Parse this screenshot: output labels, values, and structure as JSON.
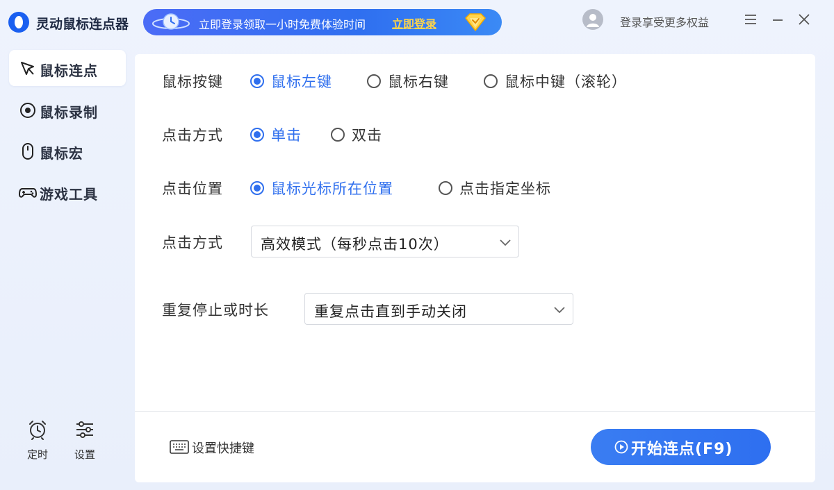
{
  "app": {
    "title": "灵动鼠标连点器"
  },
  "promo": {
    "text": "立即登录领取一小时免费体验时间",
    "link": "立即登录"
  },
  "account": {
    "login_text": "登录享受更多权益"
  },
  "sidebar": {
    "items": [
      {
        "label": "鼠标连点",
        "icon": "cursor-click-icon",
        "active": true
      },
      {
        "label": "鼠标录制",
        "icon": "record-icon",
        "active": false
      },
      {
        "label": "鼠标宏",
        "icon": "mouse-icon",
        "active": false
      },
      {
        "label": "游戏工具",
        "icon": "gamepad-icon",
        "active": false
      }
    ],
    "bottom": [
      {
        "label": "定时",
        "icon": "alarm-clock-icon"
      },
      {
        "label": "设置",
        "icon": "sliders-icon"
      }
    ]
  },
  "form": {
    "mouse_button": {
      "label": "鼠标按键",
      "options": [
        "鼠标左键",
        "鼠标右键",
        "鼠标中键（滚轮）"
      ],
      "selected": "鼠标左键"
    },
    "click_type": {
      "label": "点击方式",
      "options": [
        "单击",
        "双击"
      ],
      "selected": "单击"
    },
    "click_position": {
      "label": "点击位置",
      "options": [
        "鼠标光标所在位置",
        "点击指定坐标"
      ],
      "selected": "鼠标光标所在位置"
    },
    "click_mode": {
      "label": "点击方式",
      "value": "高效模式（每秒点击10次）"
    },
    "repeat": {
      "label": "重复停止或时长",
      "value": "重复点击直到手动关闭"
    }
  },
  "footer": {
    "shortcut_label": "设置快捷键",
    "start_label": "开始连点(F9)"
  },
  "colors": {
    "accent": "#2f6fee",
    "promo_link": "#ffd54a",
    "background": "#eef3fd"
  }
}
